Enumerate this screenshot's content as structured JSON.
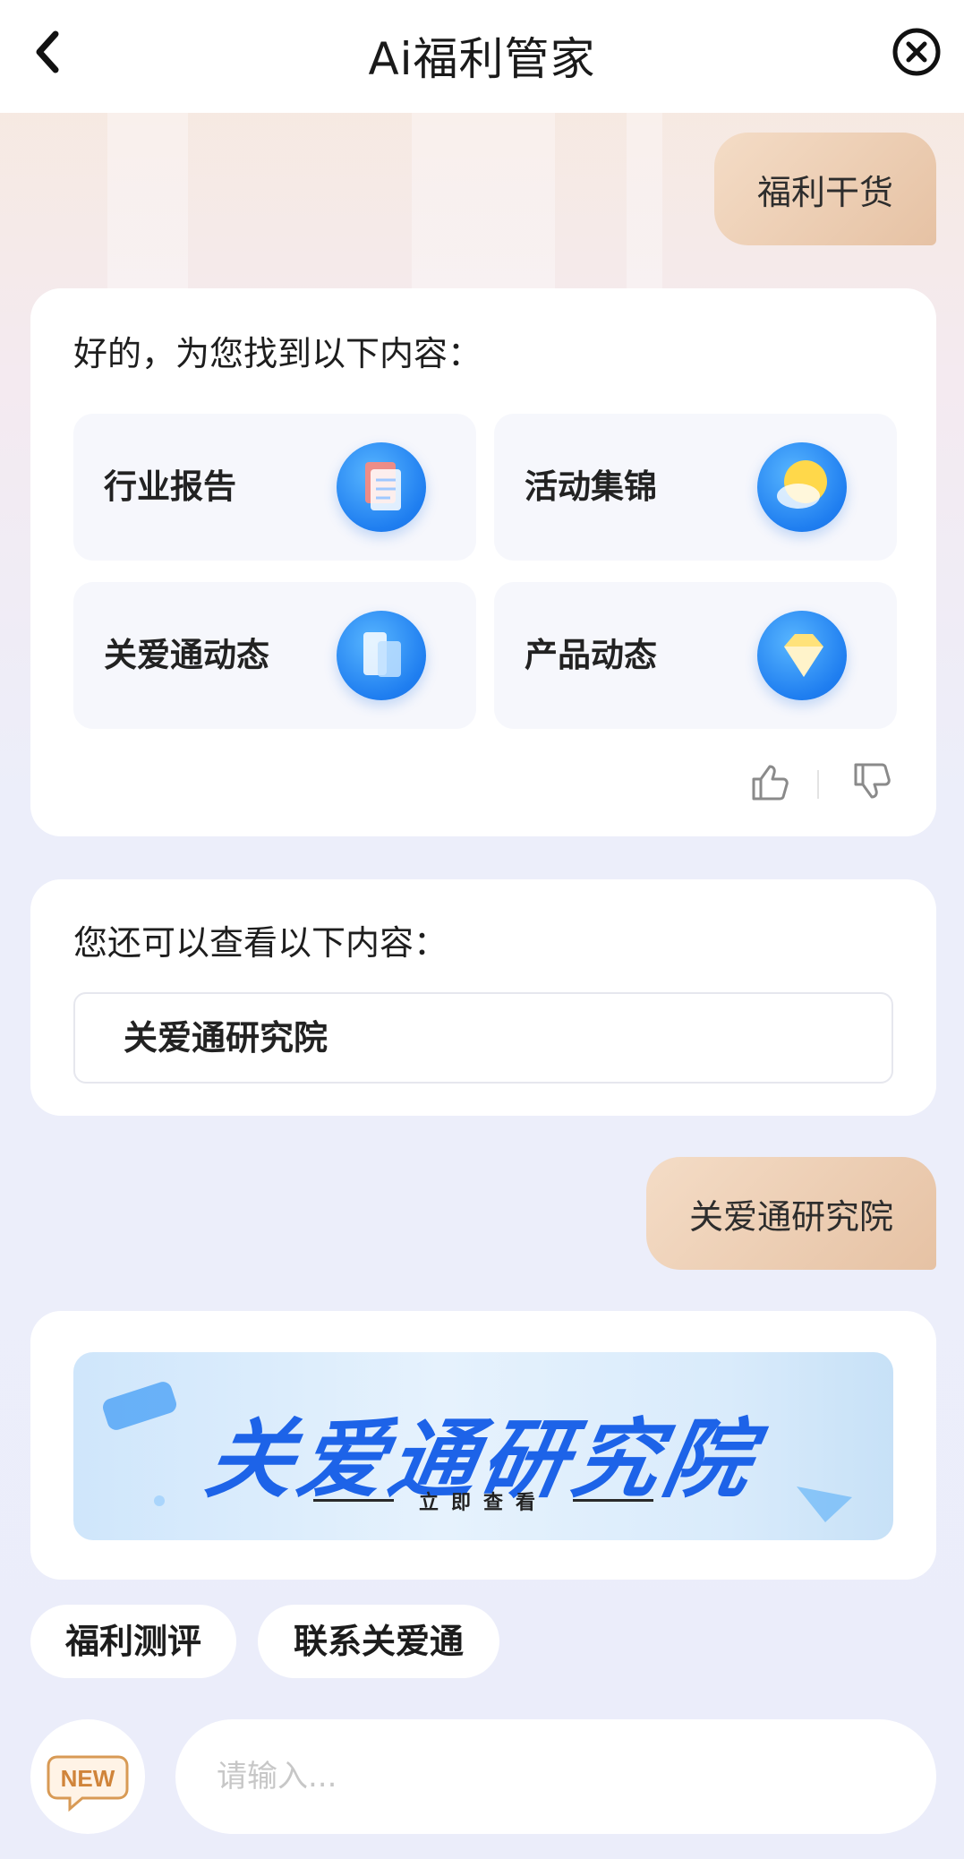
{
  "header": {
    "title": "Ai福利管家"
  },
  "chat": {
    "user_msg_1": "福利干货",
    "reply_1": {
      "intro": "好的，为您找到以下内容：",
      "tiles": [
        {
          "label": "行业报告",
          "icon": "document-icon"
        },
        {
          "label": "活动集锦",
          "icon": "sun-cloud-icon"
        },
        {
          "label": "关爱通动态",
          "icon": "files-icon"
        },
        {
          "label": "产品动态",
          "icon": "diamond-icon"
        }
      ]
    },
    "reply_2": {
      "intro": "您还可以查看以下内容：",
      "items": [
        "关爱通研究院"
      ]
    },
    "user_msg_2": "关爱通研究院",
    "banner": {
      "title": "关爱通研究院",
      "subtitle": "立即查看"
    }
  },
  "quick_replies": [
    "福利测评",
    "联系关爱通"
  ],
  "input": {
    "placeholder": "请输入...",
    "new_badge": "NEW"
  },
  "colors": {
    "accent_blue": "#1d63e8",
    "user_bubble": "#e9c8ab",
    "background": "#eceefa"
  }
}
